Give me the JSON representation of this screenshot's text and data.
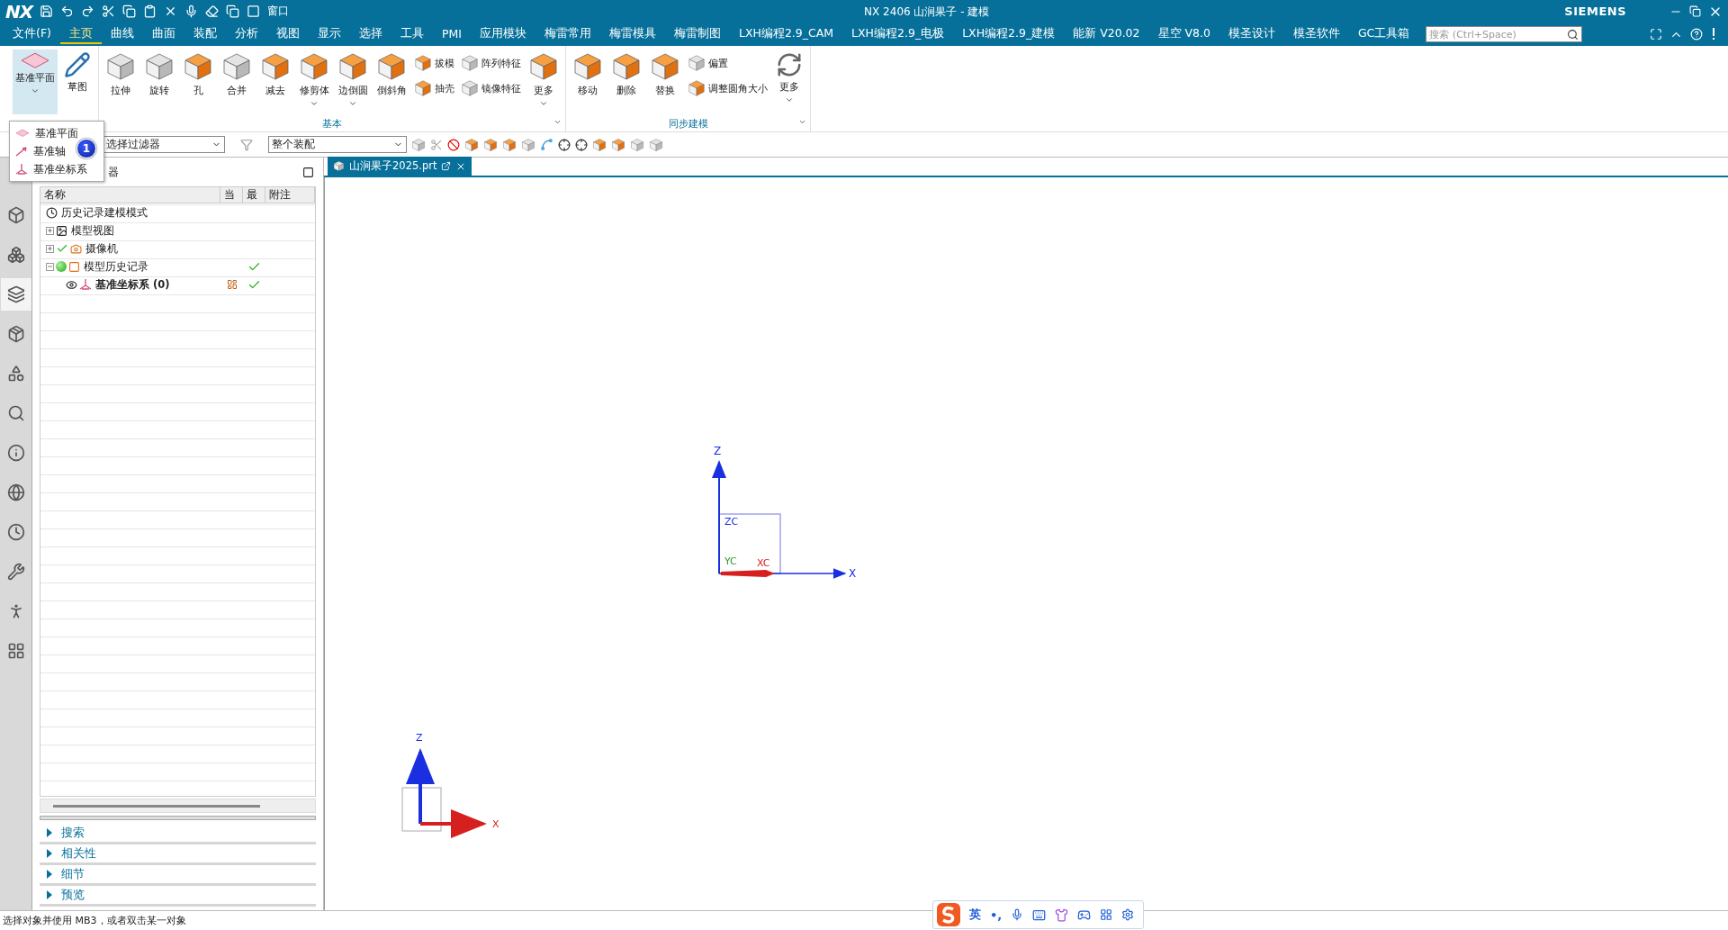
{
  "title_bar": {
    "logo": "NX",
    "window_menu": "窗口",
    "title": "NX 2406 山涧果子 - 建模",
    "brand": "SIEMENS"
  },
  "menu": {
    "items": [
      {
        "label": "文件(F)",
        "selected": false
      },
      {
        "label": "主页",
        "selected": true
      },
      {
        "label": "曲线",
        "selected": false
      },
      {
        "label": "曲面",
        "selected": false
      },
      {
        "label": "装配",
        "selected": false
      },
      {
        "label": "分析",
        "selected": false
      },
      {
        "label": "视图",
        "selected": false
      },
      {
        "label": "显示",
        "selected": false
      },
      {
        "label": "选择",
        "selected": false
      },
      {
        "label": "工具",
        "selected": false
      },
      {
        "label": "PMI",
        "selected": false
      },
      {
        "label": "应用模块",
        "selected": false
      },
      {
        "label": "梅雷常用",
        "selected": false
      },
      {
        "label": "梅雷模具",
        "selected": false
      },
      {
        "label": "梅雷制图",
        "selected": false
      },
      {
        "label": "LXH编程2.9_CAM",
        "selected": false
      },
      {
        "label": "LXH编程2.9_电极",
        "selected": false
      },
      {
        "label": "LXH编程2.9_建模",
        "selected": false
      },
      {
        "label": "能新 V20.02",
        "selected": false
      },
      {
        "label": "星空 V8.0",
        "selected": false
      },
      {
        "label": "模圣设计",
        "selected": false
      },
      {
        "label": "模圣软件",
        "selected": false
      },
      {
        "label": "GC工具箱",
        "selected": false
      }
    ],
    "search": {
      "placeholder": "搜索 (Ctrl+Space)"
    }
  },
  "ribbon": {
    "groups": [
      {
        "items": [
          {
            "kind": "large",
            "label": "基准平面",
            "dropdown": true,
            "expanded": true
          },
          {
            "kind": "large",
            "label": "草图",
            "dropdown": false,
            "expanded": false
          }
        ]
      },
      {
        "label": "基本",
        "items": [
          {
            "kind": "large",
            "label": "拉伸",
            "dropdown": false,
            "expanded": false
          },
          {
            "kind": "large",
            "label": "旋转",
            "dropdown": false,
            "expanded": false
          },
          {
            "kind": "large",
            "label": "孔",
            "dropdown": false,
            "expanded": false
          },
          {
            "kind": "large",
            "label": "合并",
            "dropdown": false,
            "expanded": false
          },
          {
            "kind": "large",
            "label": "减去",
            "dropdown": false,
            "expanded": false
          },
          {
            "kind": "large",
            "label": "修剪体",
            "dropdown": true,
            "expanded": false
          },
          {
            "kind": "large",
            "label": "边倒圆",
            "dropdown": true,
            "expanded": false
          },
          {
            "kind": "large",
            "label": "倒斜角",
            "dropdown": false,
            "expanded": false
          },
          {
            "kind": "stack",
            "items": [
              {
                "label": "拔模"
              },
              {
                "label": "抽壳"
              }
            ]
          },
          {
            "kind": "stack",
            "items": [
              {
                "label": "阵列特征"
              },
              {
                "label": "镜像特征"
              }
            ]
          },
          {
            "kind": "large",
            "label": "更多",
            "dropdown": true,
            "expanded": false
          }
        ]
      },
      {
        "label": "同步建模",
        "items": [
          {
            "kind": "large",
            "label": "移动",
            "dropdown": false,
            "expanded": false
          },
          {
            "kind": "large",
            "label": "删除",
            "dropdown": false,
            "expanded": false
          },
          {
            "kind": "large",
            "label": "替换",
            "dropdown": false,
            "expanded": false
          },
          {
            "kind": "stack",
            "items": [
              {
                "label": "偏置"
              },
              {
                "label": "调整圆角大小"
              }
            ]
          },
          {
            "kind": "large",
            "label": "更多",
            "dropdown": true,
            "expanded": false
          }
        ]
      }
    ]
  },
  "datum_menu": {
    "items": [
      {
        "label": "基准平面"
      },
      {
        "label": "基准轴"
      },
      {
        "label": "基准坐标系"
      }
    ],
    "callout": "1"
  },
  "selection_bar": {
    "filter": "选择过滤器",
    "scope": "整个装配"
  },
  "resource_bar": {
    "tabs": [
      {
        "selected": false
      },
      {
        "selected": false
      },
      {
        "selected": true
      },
      {
        "selected": false
      },
      {
        "selected": false
      },
      {
        "selected": false
      },
      {
        "selected": false
      },
      {
        "selected": false
      },
      {
        "selected": false
      },
      {
        "selected": false
      },
      {
        "selected": false
      },
      {
        "selected": false
      }
    ]
  },
  "navigator": {
    "title": "器",
    "columns": [
      "名称",
      "当",
      "最",
      "附注"
    ],
    "tree": [
      {
        "kind": "mode",
        "label": "历史记录建模模式",
        "checked": false,
        "current": false,
        "latest": false
      },
      {
        "kind": "views",
        "label": "模型视图",
        "expanded": false,
        "checked": false,
        "current": false,
        "latest": false
      },
      {
        "kind": "cameras",
        "label": "摄像机",
        "expanded": false,
        "checked": true,
        "current": false,
        "latest": false
      },
      {
        "kind": "history",
        "label": "模型历史记录",
        "expanded": true,
        "checked": false,
        "current": false,
        "latest": true,
        "children": [
          {
            "kind": "datum",
            "label": "基准坐标系 (0)",
            "checked": false,
            "current": true,
            "latest": true
          }
        ]
      }
    ],
    "sections": [
      {
        "label": "搜索",
        "expanded": false
      },
      {
        "label": "相关性",
        "expanded": false
      },
      {
        "label": "细节",
        "expanded": false
      },
      {
        "label": "预览",
        "expanded": false
      }
    ]
  },
  "viewport": {
    "tab": {
      "label": "山涧果子2025.prt",
      "selected": true
    },
    "world_triad": {
      "z": "Z",
      "x": "X"
    },
    "wcs": {
      "z": "ZC",
      "y": "YC",
      "x": "XC"
    },
    "view_triad": {
      "z": "Z",
      "x": "X"
    }
  },
  "status_bar": {
    "message": "选择对象并使用 MB3，或者双击某一对象",
    "ime": {
      "mode": "英",
      "punctuation": "•,"
    }
  }
}
